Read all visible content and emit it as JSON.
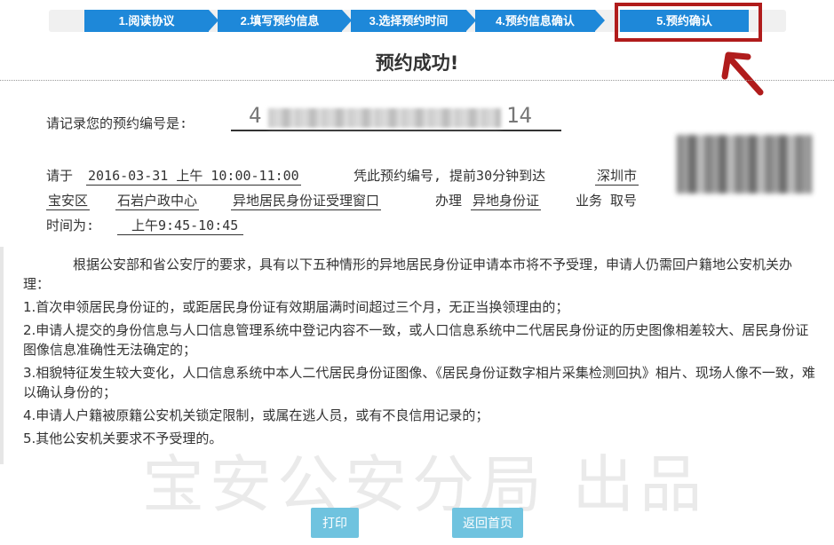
{
  "steps": [
    {
      "label": "1.阅读协议"
    },
    {
      "label": "2.填写预约信息"
    },
    {
      "label": "3.选择预约时间"
    },
    {
      "label": "4.预约信息确认"
    },
    {
      "label": "5.预约确认"
    }
  ],
  "title": "预约成功!",
  "booking": {
    "prompt": "请记录您的预约编号是:",
    "number_head": "4",
    "number_tail": "14"
  },
  "detail": {
    "p1": "请于",
    "datetime": "2016-03-31 上午 10:00-11:00",
    "p2": "凭此预约编号, 提前30分钟到达",
    "city": "深圳市",
    "district": "宝安区",
    "center": "石岩户政中心",
    "window": "异地居民身份证受理窗口",
    "p3": "办理",
    "business": "异地身份证",
    "p4": "业务 取号",
    "p5": "时间为:",
    "pickup_time": "上午9:45-10:45"
  },
  "notice": {
    "intro": "根据公安部和省公安厅的要求，具有以下五种情形的异地居民身份证申请本市将不予受理，申请人仍需回户籍地公安机关办理：",
    "items": [
      "1.首次申领居民身份证的，或距居民身份证有效期届满时间超过三个月，无正当换领理由的；",
      "2.申请人提交的身份信息与人口信息管理系统中登记内容不一致，或人口信息系统中二代居民身份证的历史图像相差较大、居民身份证图像信息准确性无法确定的；",
      "3.相貌特征发生较大变化，人口信息系统中本人二代居民身份证图像、《居民身份证数字相片采集检测回执》相片、现场人像不一致，难以确认身份的；",
      "4.申请人户籍被原籍公安机关锁定限制，或属在逃人员，或有不良信用记录的；",
      "5.其他公安机关要求不予受理的。"
    ]
  },
  "watermark": "宝安公安分局 出品",
  "buttons": {
    "print": "打印",
    "home": "返回首页"
  },
  "colors": {
    "step_blue": "#1e88d9",
    "highlight_red": "#b01c1c",
    "button_blue": "#6fc3df"
  }
}
